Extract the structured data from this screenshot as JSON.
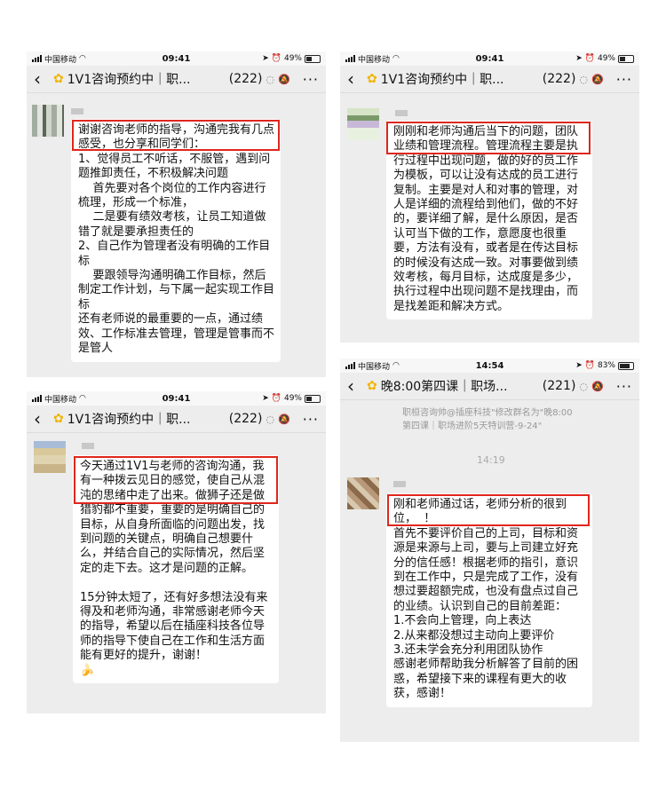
{
  "screens": [
    {
      "status": {
        "carrier": "中国移动",
        "time": "09:41",
        "battery": "49%",
        "battery_fill": 0.49
      },
      "title": "1V1咨询预约中｜职...",
      "count": "(222)",
      "message": "谢谢咨询老师的指导，沟通完我有几点感受，也分享和同学们：\n1、觉得员工不听话，不服管，遇到问题推卸责任，不积极解决问题\n    首先要对各个岗位的工作内容进行梳理，形成一个标准，\n    二是要有绩效考核，让员工知道做错了就是要承担责任的\n2、自己作为管理者没有明确的工作目标\n    要跟领导沟通明确工作目标，然后制定工作计划，与下属一起实现工作目标\n还有老师说的最重要的一点，通过绩效、工作标准去管理，管理是管事而不是管人"
    },
    {
      "status": {
        "carrier": "中国移动",
        "time": "09:41",
        "battery": "49%",
        "battery_fill": 0.49
      },
      "title": "1V1咨询预约中｜职...",
      "count": "(222)",
      "message": "刚刚和老师沟通后当下的问题，团队业绩和管理流程。管理流程主要是执行过程中出现问题，做的好的员工作为模板，可以让没有达成的员工进行复制。主要是对人和对事的管理，对人是详细的流程给到他们，做的不好的，要详细了解，是什么原因，是否认可当下做的工作，意愿度也很重要，方法有没有，或者是在传达目标的时候没有达成一致。对事要做到绩效考核，每月目标，达成度是多少，执行过程中出现问题不是找理由，而是找差距和解决方式。"
    },
    {
      "status": {
        "carrier": "中国移动",
        "time": "09:41",
        "battery": "49%",
        "battery_fill": 0.49
      },
      "title": "1V1咨询预约中｜职...",
      "count": "(222)",
      "message": "今天通过1V1与老师的咨询沟通，我有一种拨云见日的感觉，使自己从混沌的思绪中走了出来。做狮子还是做猎豹都不重要，重要的是明确自己的目标，从自身所面临的问题出发，找到问题的关键点，明确自己想要什么，并结合自己的实际情况，然后坚定的走下去。这才是问题的正解。\n\n15分钟太短了，还有好多想法没有来得及和老师沟通，非常感谢老师今天的指导，希望以后在插座科技各位导师的指导下使自己在工作和生活方面能有更好的提升，谢谢！",
      "emoji": "🍌"
    },
    {
      "status": {
        "carrier": "中国移动",
        "time": "14:54",
        "battery": "83%",
        "battery_fill": 0.83
      },
      "title": "晚8:00第四课｜职场...",
      "count": "(221)",
      "system_line_1": "职桓咨询帅@插座科技\"修改群名为\"晚8:00",
      "system_line_2": "第四课｜职场进阶5天特训营-9-24\"",
      "timestamp": "14:19",
      "message": "刚和老师通过话，老师分析的很到位，  ！\n首先不要评价自己的上司，目标和资源是来源与上司，要与上司建立好充分的信任感！根据老师的指引，意识到在工作中，只是完成了工作，没有想过要超额完成，也没有盘点过自己的业绩。认识到自己的目前差距：\n1.不会向上管理，向上表达\n2.从来都没想过主动向上要评价\n3.还未学会充分利用团队协作\n感谢老师帮助我分析解答了目前的困惑，希望接下来的课程有更大的收获，感谢！"
    }
  ],
  "icons": {
    "back": "chevron-left",
    "group": "sunflower",
    "muted": "bell-slash",
    "loading": "spinner",
    "more": "ellipsis"
  }
}
